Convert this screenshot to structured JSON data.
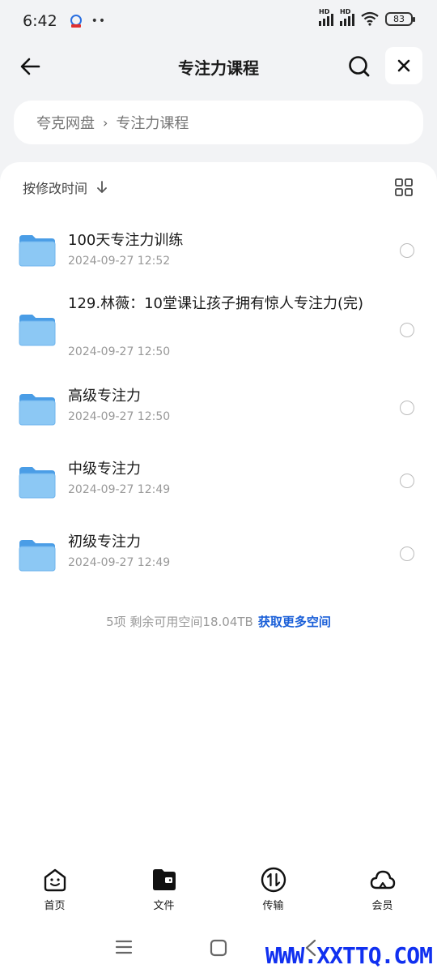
{
  "status": {
    "time": "6:42",
    "dots": "••",
    "hd1": "HD",
    "hd2": "HD",
    "battery": "83"
  },
  "header": {
    "title": "专注力课程"
  },
  "breadcrumb": {
    "root": "夸克网盘",
    "separator": "›",
    "current": "专注力课程"
  },
  "sort": {
    "label": "按修改时间"
  },
  "files": [
    {
      "name": "100天专注力训练",
      "date": "2024-09-27 12:52"
    },
    {
      "name": "129.林薇：10堂课让孩子拥有惊人专注力(完)",
      "date": "2024-09-27 12:50"
    },
    {
      "name": "高级专注力",
      "date": "2024-09-27 12:50"
    },
    {
      "name": "中级专注力",
      "date": "2024-09-27 12:49"
    },
    {
      "name": "初级专注力",
      "date": "2024-09-27 12:49"
    }
  ],
  "footer": {
    "summary": "5项 剩余可用空间18.04TB",
    "link": "获取更多空间"
  },
  "tabs": [
    {
      "label": "首页",
      "icon": "home-face-icon"
    },
    {
      "label": "文件",
      "icon": "folder-file-icon"
    },
    {
      "label": "传输",
      "icon": "transfer-icon"
    },
    {
      "label": "会员",
      "icon": "cloud-icon"
    }
  ],
  "watermark": "WWW.XXTTQ.COM",
  "colors": {
    "accent": "#1a5fd8",
    "folder": "#5aa9ec",
    "background": "#f2f3f5"
  }
}
